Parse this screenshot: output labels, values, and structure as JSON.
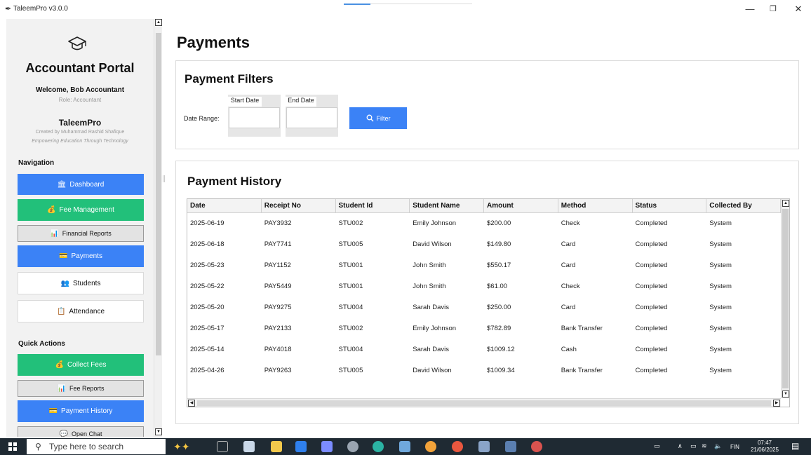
{
  "window": {
    "title": "TaleemPro v3.0.0",
    "controls": {
      "minimize": "—",
      "maximize": "❐",
      "close": "✕"
    }
  },
  "sidebar": {
    "portal_title": "Accountant Portal",
    "welcome": "Welcome, Bob Accountant",
    "role": "Role: Accountant",
    "brand": "TaleemPro",
    "created_by": "Created by Muhammad Rashid Shafique",
    "tagline": "Empowering Education Through Technology",
    "navigation_label": "Navigation",
    "nav_items": [
      {
        "label": "Dashboard",
        "icon": "🏛"
      },
      {
        "label": "Fee Management",
        "icon": "💰"
      },
      {
        "label": "Financial Reports",
        "icon": "📊"
      },
      {
        "label": "Payments",
        "icon": "💳"
      },
      {
        "label": "Students",
        "icon": "👥"
      },
      {
        "label": "Attendance",
        "icon": "📋"
      }
    ],
    "quick_actions_label": "Quick Actions",
    "quick_actions": [
      {
        "label": "Collect Fees",
        "icon": "💰"
      },
      {
        "label": "Fee Reports",
        "icon": "📊"
      },
      {
        "label": "Payment History",
        "icon": "💳"
      },
      {
        "label": "Open Chat",
        "icon": "💬"
      }
    ]
  },
  "main": {
    "page_title": "Payments",
    "filters": {
      "title": "Payment Filters",
      "date_range_label": "Date Range:",
      "start_date_label": "Start Date",
      "end_date_label": "End Date",
      "start_date_value": "",
      "end_date_value": "",
      "filter_button": "Filter",
      "filter_icon": "search-icon"
    },
    "history": {
      "title": "Payment History",
      "columns": [
        "Date",
        "Receipt No",
        "Student Id",
        "Student Name",
        "Amount",
        "Method",
        "Status",
        "Collected By"
      ],
      "rows": [
        [
          "2025-06-19",
          "PAY3932",
          "STU002",
          "Emily Johnson",
          "$200.00",
          "Check",
          "Completed",
          "System"
        ],
        [
          "2025-06-18",
          "PAY7741",
          "STU005",
          "David Wilson",
          "$149.80",
          "Card",
          "Completed",
          "System"
        ],
        [
          "2025-05-23",
          "PAY1152",
          "STU001",
          "John Smith",
          "$550.17",
          "Card",
          "Completed",
          "System"
        ],
        [
          "2025-05-22",
          "PAY5449",
          "STU001",
          "John Smith",
          "$61.00",
          "Check",
          "Completed",
          "System"
        ],
        [
          "2025-05-20",
          "PAY9275",
          "STU004",
          "Sarah Davis",
          "$250.00",
          "Card",
          "Completed",
          "System"
        ],
        [
          "2025-05-17",
          "PAY2133",
          "STU002",
          "Emily Johnson",
          "$782.89",
          "Bank Transfer",
          "Completed",
          "System"
        ],
        [
          "2025-05-14",
          "PAY4018",
          "STU004",
          "Sarah Davis",
          "$1009.12",
          "Cash",
          "Completed",
          "System"
        ],
        [
          "2025-04-26",
          "PAY9263",
          "STU005",
          "David Wilson",
          "$1009.34",
          "Bank Transfer",
          "Completed",
          "System"
        ]
      ]
    }
  },
  "taskbar": {
    "search_placeholder": "Type here to search",
    "language": "FIN",
    "time": "07:47",
    "date": "21/06/2025"
  },
  "colors": {
    "primary_blue": "#3b82f6",
    "success_green": "#22c07a",
    "taskbar": "#1f2a33"
  }
}
